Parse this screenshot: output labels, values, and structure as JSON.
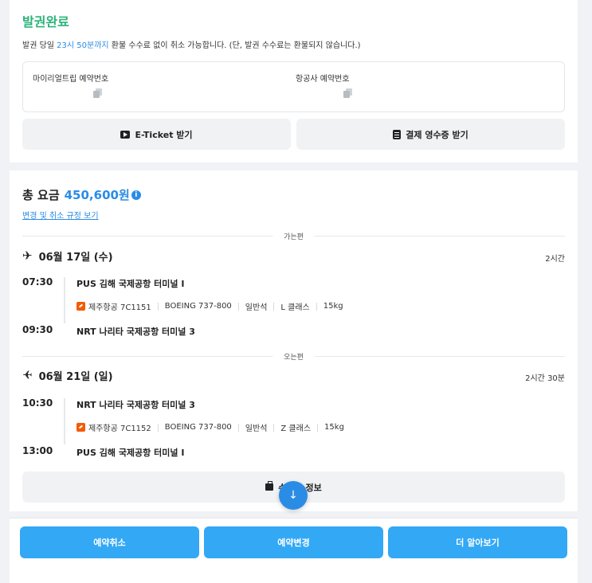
{
  "status": {
    "title": "발권완료",
    "notice_prefix": "발권 당일",
    "notice_deadline": "23시 50분까지",
    "notice_suffix": "환불 수수료 없이 취소 가능합니다. (단, 발권 수수료는 환불되지 않습니다.)"
  },
  "references": {
    "myrealtrip_label": "마이리얼트립 예약번호",
    "airline_label": "항공사 예약번호"
  },
  "actions": {
    "eticket_label": "E-Ticket 받기",
    "receipt_label": "결제 영수증 받기"
  },
  "fare": {
    "label": "총 요금",
    "amount": "450,600원",
    "rules_link": "변경 및 취소 규정 보기"
  },
  "outbound": {
    "section_label": "가는편",
    "date": "06월 17일 (수)",
    "duration": "2시간",
    "depart_time": "07:30",
    "depart_airport": "PUS 김해 국제공항 터미널 I",
    "airline": "제주항공 7C1151",
    "aircraft": "BOEING 737-800",
    "cabin": "일반석",
    "fare_class": "L 클래스",
    "baggage": "15kg",
    "arrive_time": "09:30",
    "arrive_airport": "NRT 나리타 국제공항 터미널 3"
  },
  "inbound": {
    "section_label": "오는편",
    "date": "06월 21일 (일)",
    "duration": "2시간 30분",
    "depart_time": "10:30",
    "depart_airport": "NRT 나리타 국제공항 터미널 3",
    "airline": "제주항공 7C1152",
    "aircraft": "BOEING 737-800",
    "cabin": "일반석",
    "fare_class": "Z 클래스",
    "baggage": "15kg",
    "arrive_time": "13:00",
    "arrive_airport": "PUS 김해 국제공항 터미널 I"
  },
  "baggage_button": {
    "label": "수하물 정보"
  },
  "fab_icon": "↓",
  "bottom_buttons": {
    "cancel": "예약취소",
    "change": "예약변경",
    "more": "더 알아보기"
  },
  "colors": {
    "status_green": "#2db37a",
    "accent_blue": "#2b8ce6",
    "button_blue": "#33a8f5",
    "airline_orange": "#f25c05"
  }
}
